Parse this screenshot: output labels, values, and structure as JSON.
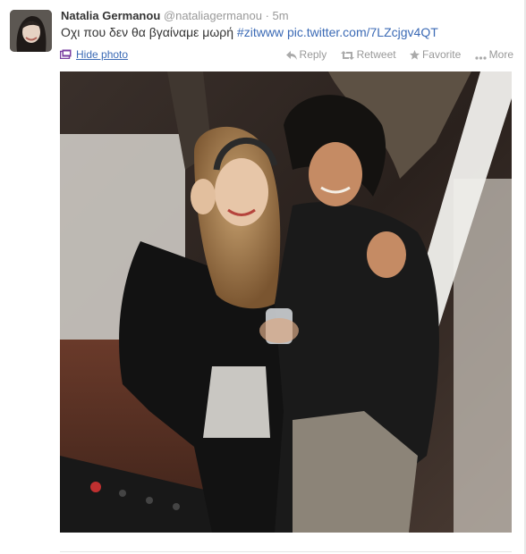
{
  "tweet": {
    "author_name": "Natalia Germanou",
    "author_handle": "@nataliagermanou",
    "separator": "·",
    "time": "5m",
    "text_main": "Οχι που δεν θα βγαίναμε μωρή ",
    "hashtag": "#zitwww",
    "link": "pic.twitter.com/7LZcjgv4QT"
  },
  "actions": {
    "hide_photo": "Hide photo",
    "reply": "Reply",
    "retweet": "Retweet",
    "favorite": "Favorite",
    "more": "More"
  },
  "colors": {
    "link": "#3b6ab5",
    "muted": "#999999",
    "text": "#333333"
  },
  "icons": [
    "photo-icon",
    "reply-icon",
    "retweet-icon",
    "favorite-icon",
    "more-icon"
  ]
}
